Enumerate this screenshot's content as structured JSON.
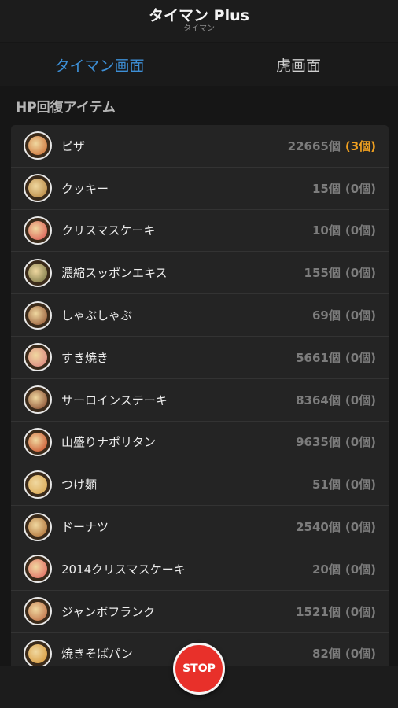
{
  "header": {
    "title": "タイマン Plus",
    "subtitle": "タイマン"
  },
  "tabs": [
    {
      "label": "タイマン画面",
      "active": true
    },
    {
      "label": "虎画面",
      "active": false
    }
  ],
  "section": {
    "title": "HP回復アイテム"
  },
  "items": [
    {
      "name": "ピザ",
      "count": "22665個",
      "owned": "(3個)",
      "icon": "pizza-icon",
      "color": "#c8642a"
    },
    {
      "name": "クッキー",
      "count": "15個",
      "owned": "(0個)",
      "icon": "cookie-icon",
      "color": "#b07a34"
    },
    {
      "name": "クリスマスケーキ",
      "count": "10個",
      "owned": "(0個)",
      "icon": "christmas-cake-icon",
      "color": "#d84a4a"
    },
    {
      "name": "濃縮スッポンエキス",
      "count": "155個",
      "owned": "(0個)",
      "icon": "turtle-extract-icon",
      "color": "#6b6a3a"
    },
    {
      "name": "しゃぶしゃぶ",
      "count": "69個",
      "owned": "(0個)",
      "icon": "shabu-shabu-icon",
      "color": "#8a4a2a"
    },
    {
      "name": "すき焼き",
      "count": "5661個",
      "owned": "(0個)",
      "icon": "sukiyaki-icon",
      "color": "#d87a7a"
    },
    {
      "name": "サーロインステーキ",
      "count": "8364個",
      "owned": "(0個)",
      "icon": "steak-icon",
      "color": "#7a3a22"
    },
    {
      "name": "山盛りナポリタン",
      "count": "9635個",
      "owned": "(0個)",
      "icon": "napolitan-icon",
      "color": "#c4401e"
    },
    {
      "name": "つけ麺",
      "count": "51個",
      "owned": "(0個)",
      "icon": "tsukemen-icon",
      "color": "#d8a24a"
    },
    {
      "name": "ドーナツ",
      "count": "2540個",
      "owned": "(0個)",
      "icon": "donut-icon",
      "color": "#a8642a"
    },
    {
      "name": "2014クリスマスケーキ",
      "count": "20個",
      "owned": "(0個)",
      "icon": "christmas-cake-2014-icon",
      "color": "#e05a5a"
    },
    {
      "name": "ジャンボフランク",
      "count": "1521個",
      "owned": "(0個)",
      "icon": "frank-sausage-icon",
      "color": "#b8603a"
    },
    {
      "name": "焼きそばパン",
      "count": "82個",
      "owned": "(0個)",
      "icon": "yakisoba-bread-icon",
      "color": "#d4902e"
    }
  ],
  "stop_button": {
    "label": "STOP",
    "color": "#e8302a"
  }
}
